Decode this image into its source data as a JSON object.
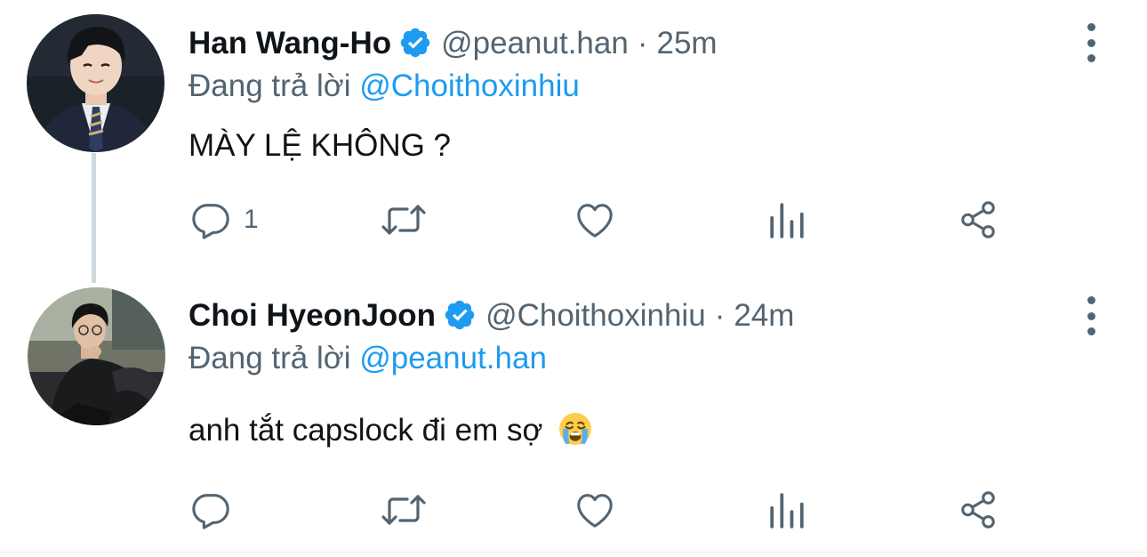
{
  "tweets": [
    {
      "name": "Han Wang-Ho",
      "handle": "@peanut.han",
      "separator": "·",
      "time": "25m",
      "reply_prefix": "Đang trả lời",
      "reply_to": "@Choithoxinhiu",
      "text": "MÀY LỆ KHÔNG ?",
      "reply_count": "1",
      "verified": true
    },
    {
      "name": "Choi HyeonJoon",
      "handle": "@Choithoxinhiu",
      "separator": "·",
      "time": "24m",
      "reply_prefix": "Đang trả lời",
      "reply_to": "@peanut.han",
      "text": "anh tắt capslock đi em sợ",
      "emoji": "😭",
      "reply_count": "",
      "verified": true
    }
  ],
  "icons": {
    "reply": "reply-icon",
    "retweet": "retweet-icon",
    "like": "heart-icon",
    "views": "bar-chart-icon",
    "share": "share-icon",
    "more": "more-options-icon",
    "verified": "verified-badge-icon"
  },
  "colors": {
    "accent": "#1d9bf0",
    "secondary_text": "#536471",
    "primary_text": "#0f1419",
    "thread_line": "#cfd9de"
  }
}
